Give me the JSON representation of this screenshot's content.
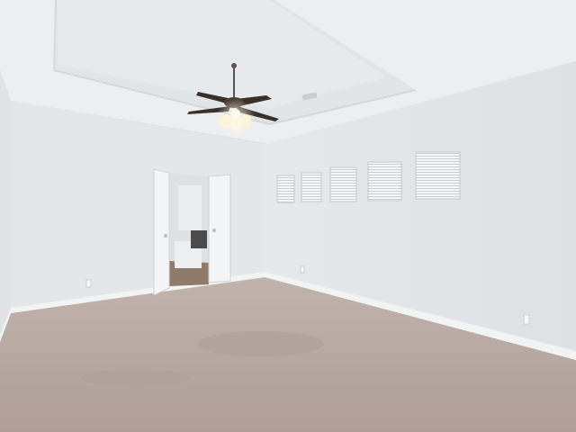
{
  "scene": {
    "subject": "empty-bedroom-interior",
    "colors": {
      "wall_left": "#e3e6e8",
      "wall_back": "#e8ebed",
      "wall_right": "#dfe3e6",
      "ceiling": "#eceef0",
      "ceiling_tray": "#e4e7ea",
      "carpet": "#b9a9a3",
      "carpet_dark": "#a89892",
      "baseboard": "#f2f3f3",
      "door": "#f4f5f6",
      "fan_blade": "#3a2f2a",
      "light_glow": "#fff3d6",
      "window_blind": "#f3f4f5",
      "bathroom_floor": "#8f7b69",
      "bathroom_wall": "#dfe3e5"
    },
    "window_count": 5,
    "icons": [
      "ceiling-fan-icon",
      "light-fixture-icon",
      "air-vent-icon",
      "electrical-outlet-icon"
    ]
  }
}
